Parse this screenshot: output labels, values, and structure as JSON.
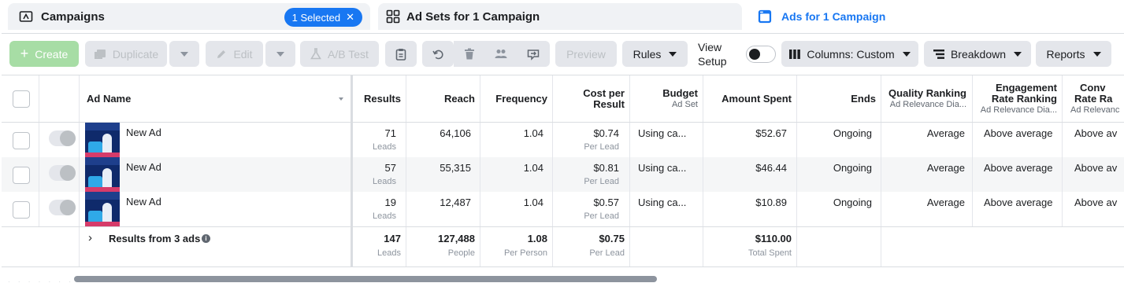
{
  "tabs": {
    "campaigns": {
      "label": "Campaigns",
      "selected_badge": "1 Selected"
    },
    "adsets": {
      "label": "Ad Sets for 1 Campaign"
    },
    "ads": {
      "label": "Ads for 1 Campaign"
    }
  },
  "toolbar": {
    "create": "Create",
    "duplicate": "Duplicate",
    "edit": "Edit",
    "ab_test": "A/B Test",
    "preview": "Preview",
    "rules": "Rules",
    "view_setup_line1": "View",
    "view_setup_line2": "Setup",
    "columns": "Columns: Custom",
    "breakdown": "Breakdown",
    "reports": "Reports"
  },
  "table": {
    "headers": {
      "ad_name": "Ad Name",
      "results": "Results",
      "reach": "Reach",
      "frequency": "Frequency",
      "cost_per_result_1": "Cost per",
      "cost_per_result_2": "Result",
      "budget": "Budget",
      "budget_sub": "Ad Set",
      "amount_spent": "Amount Spent",
      "ends": "Ends",
      "quality_ranking": "Quality Ranking",
      "quality_ranking_sub": "Ad Relevance Dia...",
      "engagement_1": "Engagement",
      "engagement_2": "Rate Ranking",
      "engagement_sub": "Ad Relevance Dia...",
      "conv_1": "Conv",
      "conv_2": "Rate Ra",
      "conv_sub": "Ad Relevanc"
    },
    "rows": [
      {
        "name": "New Ad",
        "results": "71",
        "results_sub": "Leads",
        "reach": "64,106",
        "frequency": "1.04",
        "cost": "$0.74",
        "cost_sub": "Per Lead",
        "budget": "Using ca...",
        "spent": "$52.67",
        "ends": "Ongoing",
        "quality": "Average",
        "engagement": "Above average",
        "conversion": "Above av"
      },
      {
        "name": "New Ad",
        "results": "57",
        "results_sub": "Leads",
        "reach": "55,315",
        "frequency": "1.04",
        "cost": "$0.81",
        "cost_sub": "Per Lead",
        "budget": "Using ca...",
        "spent": "$46.44",
        "ends": "Ongoing",
        "quality": "Average",
        "engagement": "Above average",
        "conversion": "Above av"
      },
      {
        "name": "New Ad",
        "results": "19",
        "results_sub": "Leads",
        "reach": "12,487",
        "frequency": "1.04",
        "cost": "$0.57",
        "cost_sub": "Per Lead",
        "budget": "Using ca...",
        "spent": "$10.89",
        "ends": "Ongoing",
        "quality": "Average",
        "engagement": "Above average",
        "conversion": "Above av"
      }
    ],
    "total": {
      "label": "Results from 3 ads",
      "results": "147",
      "results_sub": "Leads",
      "reach": "127,488",
      "reach_sub": "People",
      "frequency": "1.08",
      "frequency_sub": "Per Person",
      "cost": "$0.75",
      "cost_sub": "Per Lead",
      "spent": "$110.00",
      "spent_sub": "Total Spent"
    }
  },
  "colors": {
    "accent": "#1877f2",
    "create_disabled": "#a7dda5"
  },
  "icons": [
    "campaign-folder-icon",
    "adsets-grid-icon",
    "ad-window-icon",
    "plus-icon",
    "duplicate-icon",
    "pencil-icon",
    "flask-icon",
    "clipboard-icon",
    "undo-icon",
    "trash-icon",
    "people-icon",
    "export-icon",
    "columns-icon",
    "breakdown-icon",
    "info-icon",
    "chevron-right-icon",
    "close-icon",
    "sort-icon"
  ]
}
